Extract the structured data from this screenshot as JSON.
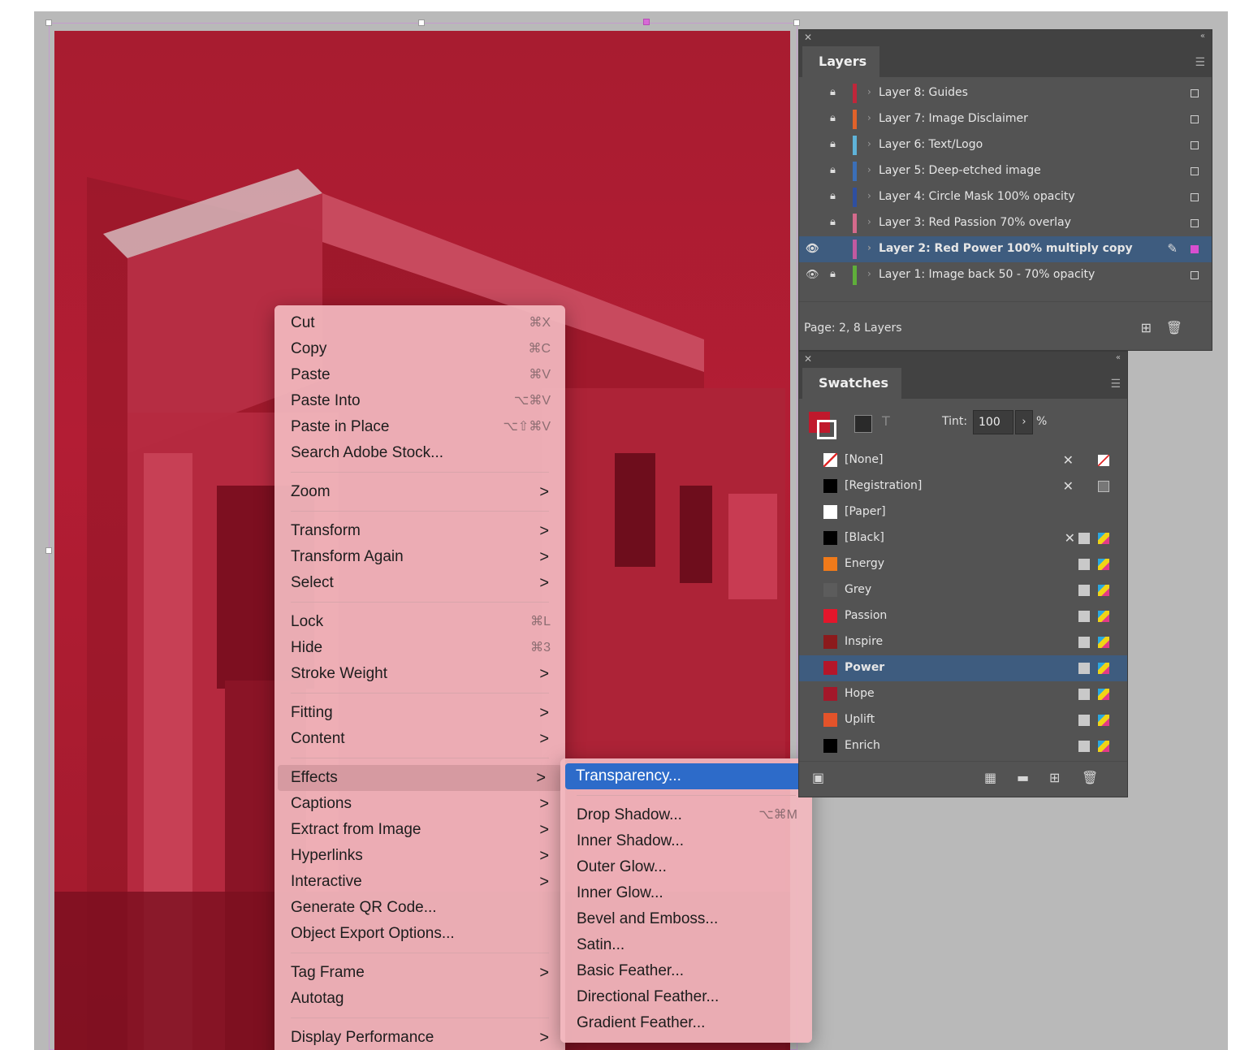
{
  "context_menu": {
    "items": [
      {
        "label": "Cut",
        "shortcut": "⌘X"
      },
      {
        "label": "Copy",
        "shortcut": "⌘C"
      },
      {
        "label": "Paste",
        "shortcut": "⌘V"
      },
      {
        "label": "Paste Into",
        "shortcut": "⌥⌘V"
      },
      {
        "label": "Paste in Place",
        "shortcut": "⌥⇧⌘V"
      },
      {
        "label": "Search Adobe Stock..."
      },
      {
        "label": "Zoom"
      },
      {
        "label": "Transform"
      },
      {
        "label": "Transform Again"
      },
      {
        "label": "Select"
      },
      {
        "label": "Lock",
        "shortcut": "⌘L"
      },
      {
        "label": "Hide",
        "shortcut": "⌘3"
      },
      {
        "label": "Stroke Weight"
      },
      {
        "label": "Fitting"
      },
      {
        "label": "Content"
      },
      {
        "label": "Effects"
      },
      {
        "label": "Captions"
      },
      {
        "label": "Extract from Image"
      },
      {
        "label": "Hyperlinks"
      },
      {
        "label": "Interactive"
      },
      {
        "label": "Generate QR Code..."
      },
      {
        "label": "Object Export Options..."
      },
      {
        "label": "Tag Frame"
      },
      {
        "label": "Autotag"
      },
      {
        "label": "Display Performance"
      }
    ],
    "arrow_glyph": ">"
  },
  "effects_submenu": {
    "items": [
      {
        "label": "Transparency..."
      },
      {
        "label": "Drop Shadow...",
        "shortcut": "⌥⌘M"
      },
      {
        "label": "Inner Shadow..."
      },
      {
        "label": "Outer Glow..."
      },
      {
        "label": "Inner Glow..."
      },
      {
        "label": "Bevel and Emboss..."
      },
      {
        "label": "Satin..."
      },
      {
        "label": "Basic Feather..."
      },
      {
        "label": "Directional Feather..."
      },
      {
        "label": "Gradient Feather..."
      }
    ]
  },
  "layers_panel": {
    "title": "Layers",
    "layers": [
      {
        "name": "Layer 8: Guides",
        "color": "#c0263a"
      },
      {
        "name": "Layer 7: Image Disclaimer",
        "color": "#e0622a"
      },
      {
        "name": "Layer 6: Text/Logo",
        "color": "#5fb3d9"
      },
      {
        "name": "Layer 5: Deep-etched image",
        "color": "#3b6fb8"
      },
      {
        "name": "Layer 4: Circle Mask 100% opacity",
        "color": "#2f4fa0"
      },
      {
        "name": "Layer 3: Red Passion 70% overlay",
        "color": "#d46a8c"
      },
      {
        "name": "Layer 2: Red Power 100% multiply copy",
        "color": "#c05aa0"
      },
      {
        "name": "Layer 1: Image back 50 - 70% opacity",
        "color": "#5fae3a"
      }
    ],
    "footer": "Page: 2, 8 Layers"
  },
  "swatches_panel": {
    "title": "Swatches",
    "tint_label": "Tint:",
    "tint_value": "100",
    "tint_unit": "%",
    "swatches": [
      {
        "name": "[None]",
        "color": "#ffffff"
      },
      {
        "name": "[Registration]",
        "color": "#000000"
      },
      {
        "name": "[Paper]",
        "color": "#ffffff"
      },
      {
        "name": "[Black]",
        "color": "#000000"
      },
      {
        "name": "Energy",
        "color": "#f07a1a"
      },
      {
        "name": "Grey",
        "color": "#5c5c5c"
      },
      {
        "name": "Passion",
        "color": "#e3162b"
      },
      {
        "name": "Inspire",
        "color": "#8c1a1c"
      },
      {
        "name": "Power",
        "color": "#b4162a"
      },
      {
        "name": "Hope",
        "color": "#a3182a"
      },
      {
        "name": "Uplift",
        "color": "#e4532a"
      },
      {
        "name": "Enrich",
        "color": "#000000"
      }
    ]
  }
}
